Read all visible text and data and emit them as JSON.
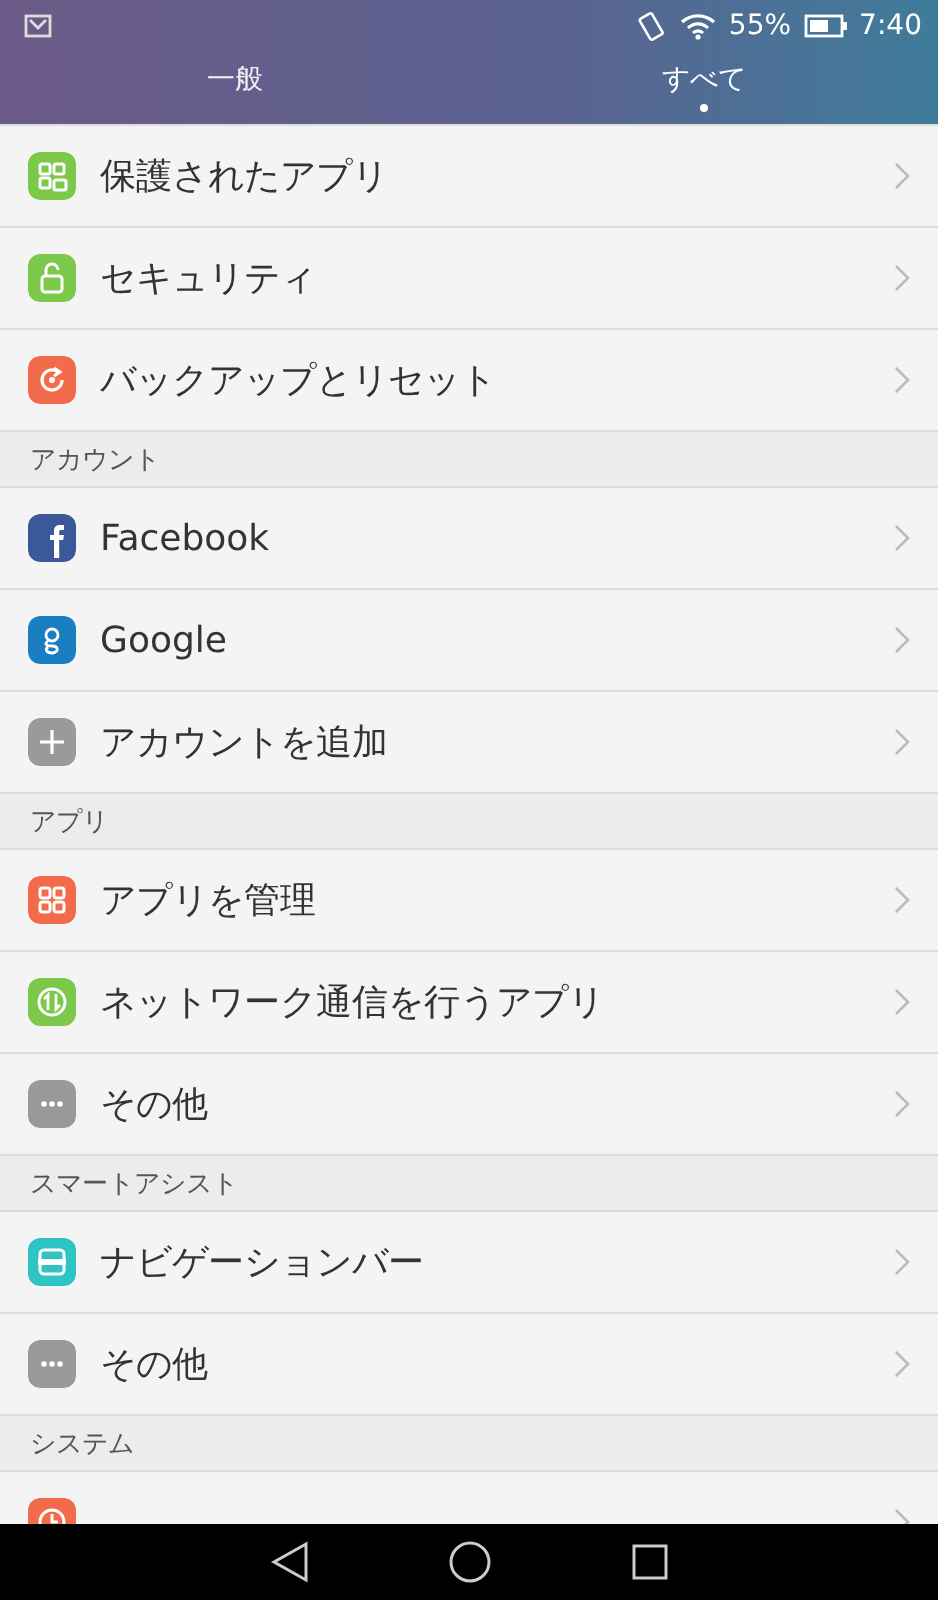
{
  "status_bar": {
    "battery": "55%",
    "time": "7:40"
  },
  "tabs": [
    {
      "label": "一般",
      "selected": false
    },
    {
      "label": "すべて",
      "selected": true
    }
  ],
  "sections": [
    {
      "items": [
        {
          "label": "保護されたアプリ",
          "kind": "grid-lock"
        },
        {
          "label": "セキュリティ",
          "kind": "lock"
        },
        {
          "label": "バックアップとリセット",
          "kind": "circle-arrow"
        }
      ]
    },
    {
      "header": "アカウント",
      "items": [
        {
          "label": "Facebook",
          "kind": "facebook"
        },
        {
          "label": "Google",
          "kind": "google"
        },
        {
          "label": "アカウントを追加",
          "kind": "plus"
        }
      ]
    },
    {
      "header": "アプリ",
      "items": [
        {
          "label": "アプリを管理",
          "kind": "grid"
        },
        {
          "label": "ネットワーク通信を行うアプリ",
          "kind": "arrows"
        },
        {
          "label": "その他",
          "kind": "dots"
        }
      ]
    },
    {
      "header": "スマートアシスト",
      "items": [
        {
          "label": "ナビゲーションバー",
          "kind": "navbar"
        },
        {
          "label": "その他",
          "kind": "dots"
        }
      ]
    },
    {
      "header": "システム",
      "items": [
        {
          "kind": "clock"
        }
      ]
    }
  ]
}
